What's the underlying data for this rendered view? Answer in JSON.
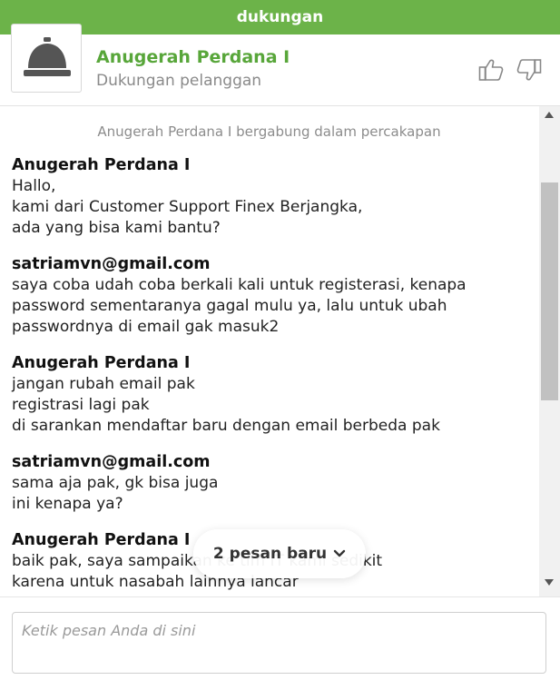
{
  "window": {
    "title": "dukungan"
  },
  "header": {
    "agent_name": "Anugerah Perdana I",
    "agent_role": "Dukungan pelanggan",
    "icons": {
      "avatar": "service-bell-icon",
      "rate_up": "thumbs-up-icon",
      "rate_down": "thumbs-down-icon"
    }
  },
  "chat": {
    "system_message": "Anugerah Perdana I bergabung dalam percakapan",
    "messages": [
      {
        "author": "Anugerah Perdana I",
        "lines": [
          "Hallo,",
          "kami dari Customer Support Finex Berjangka,",
          "ada yang bisa kami bantu?"
        ]
      },
      {
        "author": "satriamvn@gmail.com",
        "lines": [
          "saya coba udah coba berkali kali untuk registerasi, kenapa",
          "password sementaranya gagal mulu ya, lalu untuk ubah",
          "passwordnya di email gak masuk2"
        ]
      },
      {
        "author": "Anugerah Perdana I",
        "lines": [
          "jangan rubah email pak",
          "registrasi lagi pak",
          "di sarankan mendaftar baru dengan email berbeda pak"
        ]
      },
      {
        "author": "satriamvn@gmail.com",
        "lines": [
          "sama aja pak, gk bisa juga",
          "ini kenapa ya?"
        ]
      },
      {
        "author": "Anugerah Perdana I",
        "lines": [
          "baik pak, saya sampaikan ke tim IT kami sedikit",
          "karena untuk nasabah lainnya lancar"
        ]
      }
    ],
    "new_messages_label": "2 pesan baru"
  },
  "composer": {
    "placeholder": "Ketik pesan Anda di sini"
  },
  "colors": {
    "titlebar": "#6cb349",
    "agent_name": "#58a63a"
  }
}
